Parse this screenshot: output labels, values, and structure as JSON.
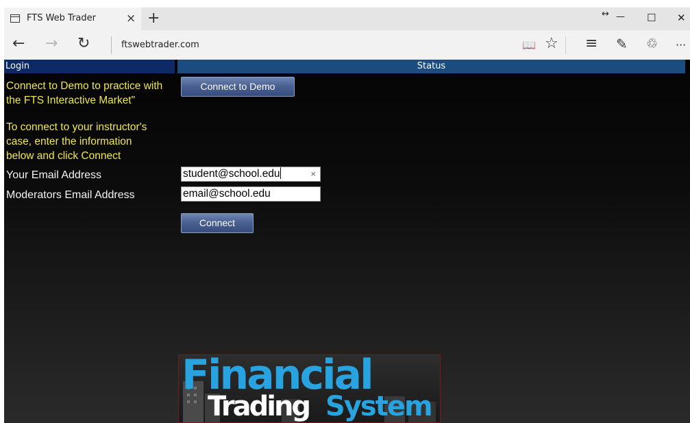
{
  "browser": {
    "tab_title": "FTS Web Trader",
    "tab_close": "×",
    "new_tab": "+",
    "address": "ftswebtrader.com",
    "icons": [
      "tab-page-icon",
      "back-arrow-icon",
      "forward-arrow-icon",
      "refresh-icon",
      "reading-view-icon",
      "favorite-star-icon",
      "hub-icon",
      "web-note-icon",
      "share-icon",
      "more-icon"
    ],
    "window_controls": {
      "restore_arrows": "↔",
      "minimize": "—",
      "maximize": "☐",
      "close": "✕"
    },
    "toolbar_glyphs": {
      "back": "←",
      "forward": "→",
      "refresh": "↻",
      "reading": "📖",
      "favorite": "☆",
      "hub": "≡",
      "note": "✎",
      "share": "♲",
      "more": "···"
    }
  },
  "page": {
    "header_login": "Login",
    "header_status": "Status",
    "demo_text_line1": "Connect to Demo to practice with",
    "demo_text_line2": "the FTS Interactive Market\"",
    "connect_demo_label": "Connect to Demo",
    "instructor_line1": "To connect to your instructor's",
    "instructor_line2": "case, enter the information",
    "instructor_line3": "below and click Connect",
    "email_label": "Your Email Address",
    "email_value": "student@school.edu",
    "moderator_label": "Moderators Email Address",
    "moderator_value": "email@school.edu",
    "connect_label": "Connect",
    "clear_glyph": "×"
  },
  "logo": {
    "word1": "Financial",
    "word2": "Trading",
    "word3": "System",
    "colors": {
      "blue": "#29a3e0",
      "white": "#ffffff"
    }
  },
  "colors": {
    "yellow_text": "#f0e84a",
    "login_header": "#0d2a66",
    "status_header": "#1b4c80",
    "button": "#4a6192"
  }
}
